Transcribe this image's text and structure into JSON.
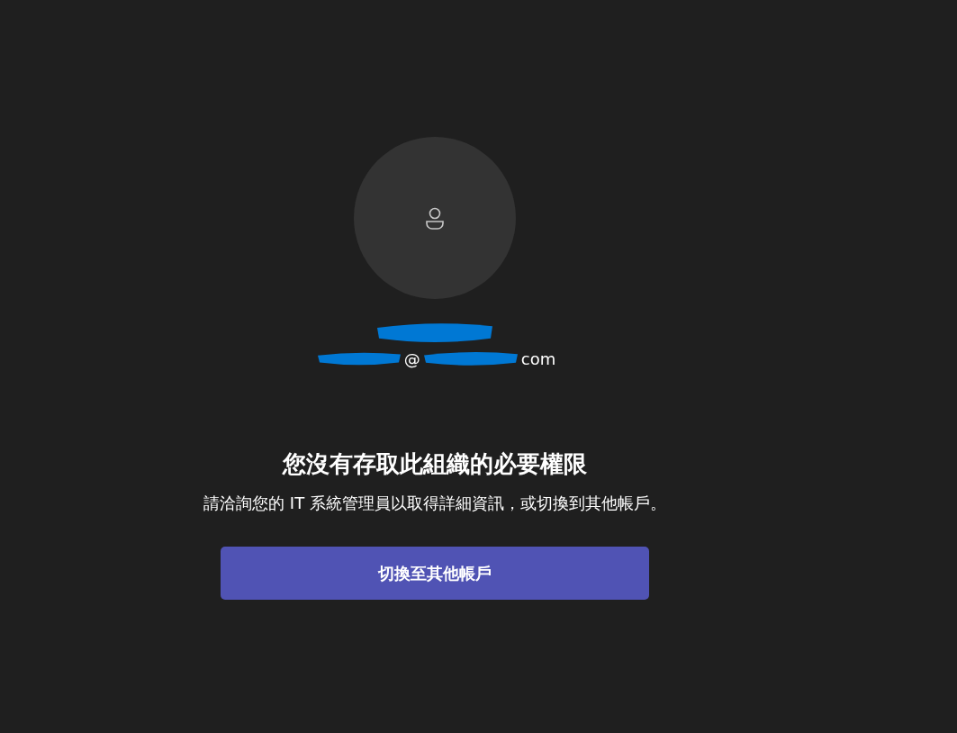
{
  "account": {
    "email_visible_parts": [
      "@",
      "com"
    ]
  },
  "message": {
    "title": "您沒有存取此組織的必要權限",
    "body": "請洽詢您的 IT 系統管理員以取得詳細資訊，或切換到其他帳戶。"
  },
  "buttons": [
    {
      "label": "切換至其他帳戶"
    }
  ]
}
